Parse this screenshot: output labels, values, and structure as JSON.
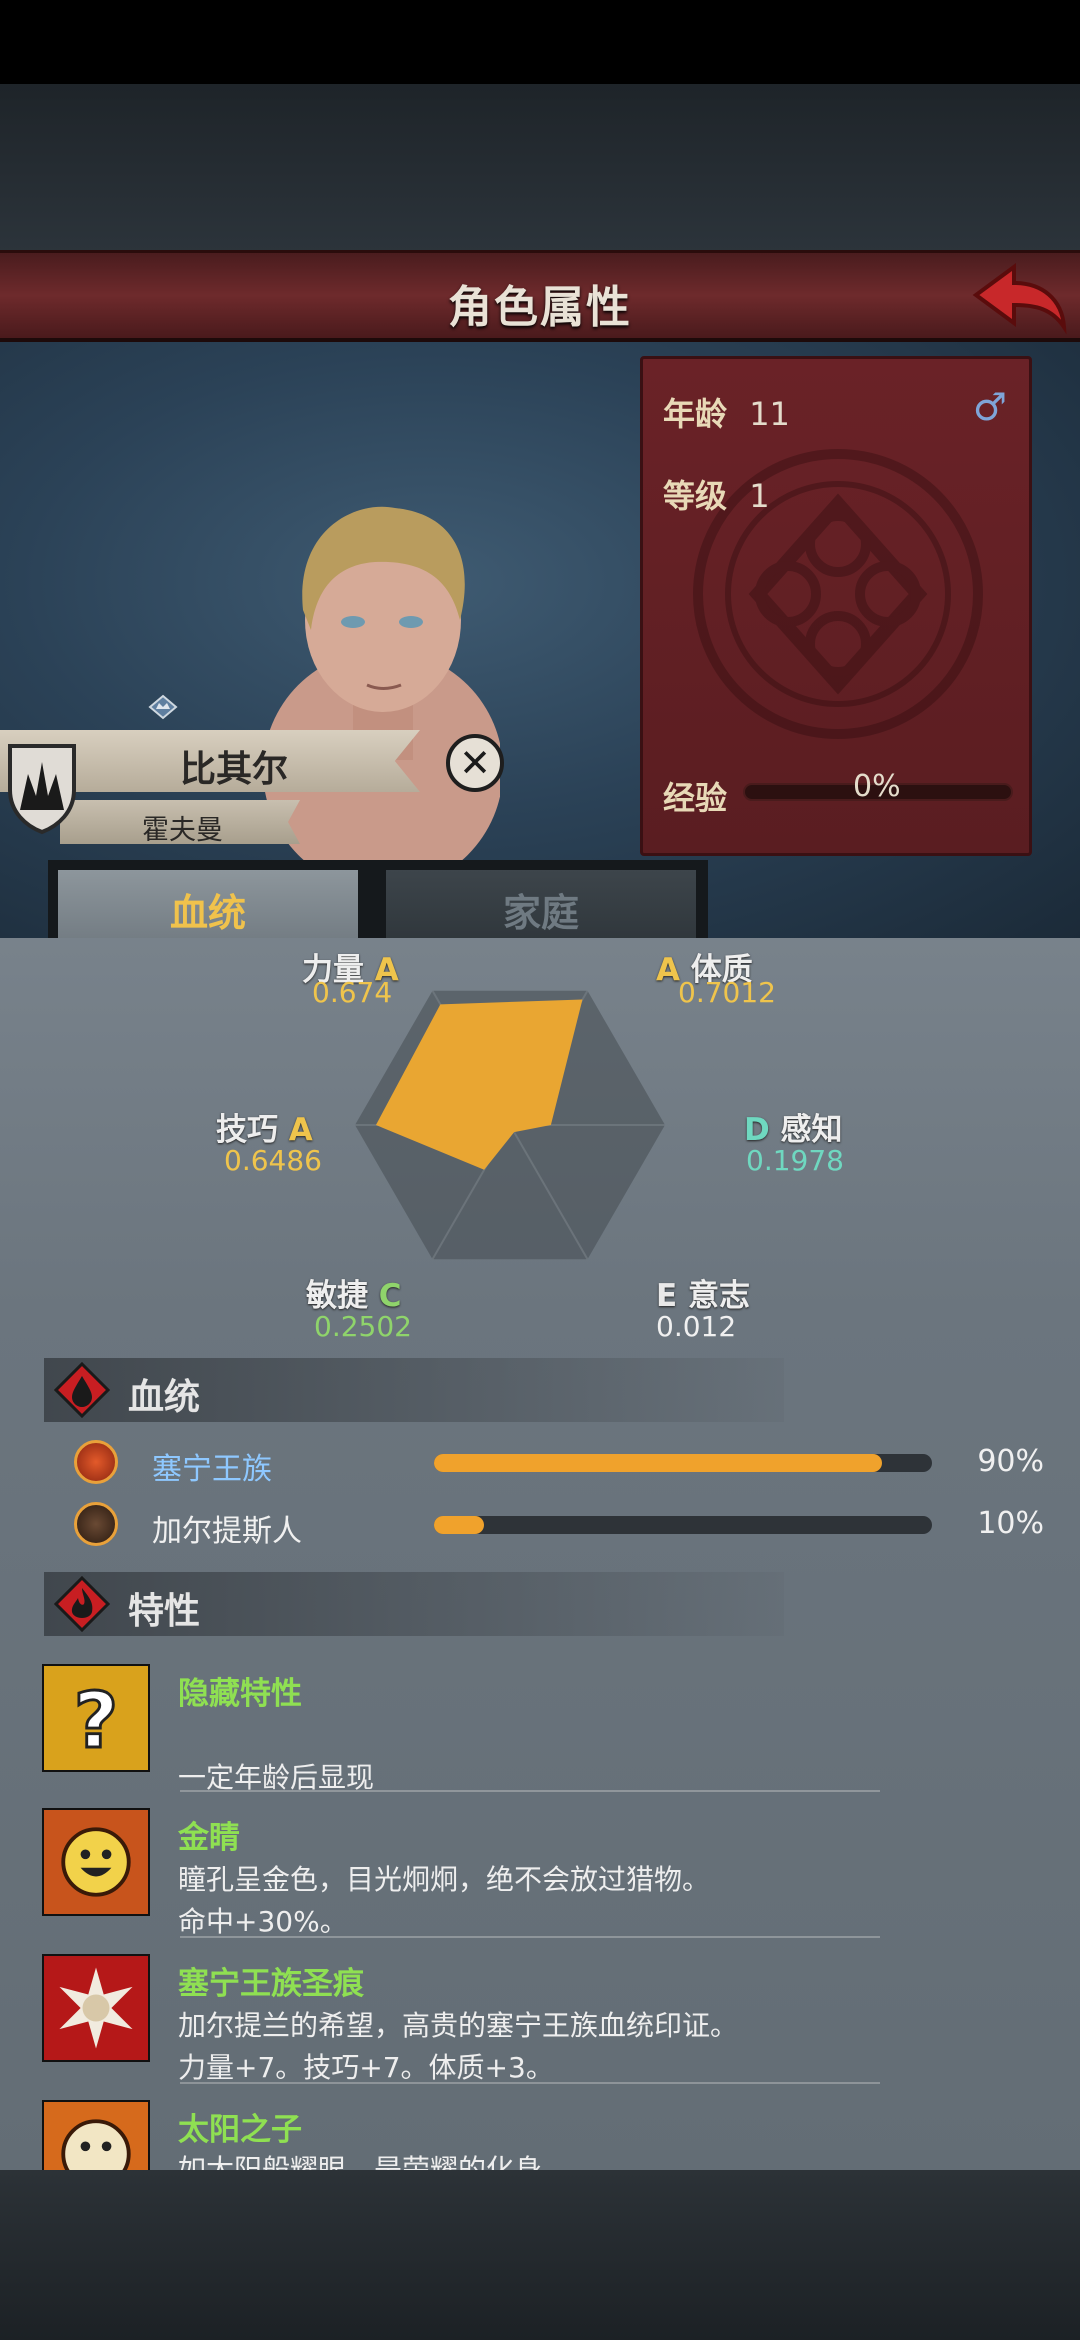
{
  "header": {
    "title": "角色属性"
  },
  "character": {
    "name": "比其尔",
    "surname": "霍夫曼",
    "age_label": "年龄",
    "age": "11",
    "level_label": "等级",
    "level": "1",
    "exp_label": "经验",
    "exp_pct": "0%",
    "gender_symbol": "♂"
  },
  "tabs": [
    {
      "label": "血统",
      "active": true
    },
    {
      "label": "家庭",
      "active": false
    }
  ],
  "radar": {
    "stats": [
      {
        "name": "力量",
        "grade": "A",
        "value": "0.674"
      },
      {
        "name": "体质",
        "grade": "A",
        "value": "0.7012"
      },
      {
        "name": "感知",
        "grade": "D",
        "value": "0.1978"
      },
      {
        "name": "意志",
        "grade": "E",
        "value": "0.012"
      },
      {
        "name": "敏捷",
        "grade": "C",
        "value": "0.2502"
      },
      {
        "name": "技巧",
        "grade": "A",
        "value": "0.6486"
      }
    ],
    "fill_color": "#e9a632"
  },
  "bloodline": {
    "title": "血统",
    "items": [
      {
        "name": "塞宁王族",
        "percent": "90%",
        "fraction": 0.9,
        "name_color": "#8ec8ff"
      },
      {
        "name": "加尔提斯人",
        "percent": "10%",
        "fraction": 0.1,
        "name_color": "#f0f0f0"
      }
    ]
  },
  "traits": {
    "title": "特性",
    "items": [
      {
        "name": "隐藏特性",
        "desc": "",
        "desc2": "一定年龄后显现",
        "icon": "question-mark-icon"
      },
      {
        "name": "金睛",
        "desc": "瞳孔呈金色，目光炯炯，绝不会放过猎物。",
        "desc2": "命中+30%。",
        "icon": "smiling-face-icon"
      },
      {
        "name": "塞宁王族圣痕",
        "desc": "加尔提兰的希望，高贵的塞宁王族血统印证。",
        "desc2": "力量+7。技巧+7。体质+3。",
        "icon": "sun-emblem-icon"
      },
      {
        "name": "太阳之子",
        "desc": "如太阳般耀眼，是荣耀的化身。",
        "desc2": "",
        "icon": "smiling-face-icon"
      }
    ]
  }
}
